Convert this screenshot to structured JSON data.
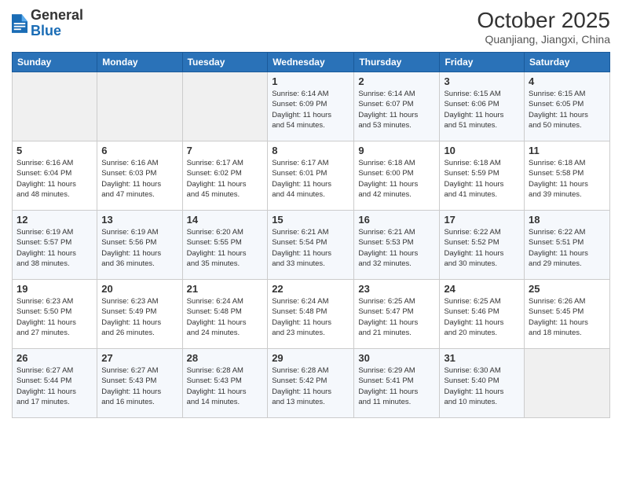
{
  "logo": {
    "general": "General",
    "blue": "Blue"
  },
  "header": {
    "title": "October 2025",
    "subtitle": "Quanjiang, Jiangxi, China"
  },
  "columns": [
    "Sunday",
    "Monday",
    "Tuesday",
    "Wednesday",
    "Thursday",
    "Friday",
    "Saturday"
  ],
  "weeks": [
    [
      {
        "day": "",
        "info": ""
      },
      {
        "day": "",
        "info": ""
      },
      {
        "day": "",
        "info": ""
      },
      {
        "day": "1",
        "info": "Sunrise: 6:14 AM\nSunset: 6:09 PM\nDaylight: 11 hours\nand 54 minutes."
      },
      {
        "day": "2",
        "info": "Sunrise: 6:14 AM\nSunset: 6:07 PM\nDaylight: 11 hours\nand 53 minutes."
      },
      {
        "day": "3",
        "info": "Sunrise: 6:15 AM\nSunset: 6:06 PM\nDaylight: 11 hours\nand 51 minutes."
      },
      {
        "day": "4",
        "info": "Sunrise: 6:15 AM\nSunset: 6:05 PM\nDaylight: 11 hours\nand 50 minutes."
      }
    ],
    [
      {
        "day": "5",
        "info": "Sunrise: 6:16 AM\nSunset: 6:04 PM\nDaylight: 11 hours\nand 48 minutes."
      },
      {
        "day": "6",
        "info": "Sunrise: 6:16 AM\nSunset: 6:03 PM\nDaylight: 11 hours\nand 47 minutes."
      },
      {
        "day": "7",
        "info": "Sunrise: 6:17 AM\nSunset: 6:02 PM\nDaylight: 11 hours\nand 45 minutes."
      },
      {
        "day": "8",
        "info": "Sunrise: 6:17 AM\nSunset: 6:01 PM\nDaylight: 11 hours\nand 44 minutes."
      },
      {
        "day": "9",
        "info": "Sunrise: 6:18 AM\nSunset: 6:00 PM\nDaylight: 11 hours\nand 42 minutes."
      },
      {
        "day": "10",
        "info": "Sunrise: 6:18 AM\nSunset: 5:59 PM\nDaylight: 11 hours\nand 41 minutes."
      },
      {
        "day": "11",
        "info": "Sunrise: 6:18 AM\nSunset: 5:58 PM\nDaylight: 11 hours\nand 39 minutes."
      }
    ],
    [
      {
        "day": "12",
        "info": "Sunrise: 6:19 AM\nSunset: 5:57 PM\nDaylight: 11 hours\nand 38 minutes."
      },
      {
        "day": "13",
        "info": "Sunrise: 6:19 AM\nSunset: 5:56 PM\nDaylight: 11 hours\nand 36 minutes."
      },
      {
        "day": "14",
        "info": "Sunrise: 6:20 AM\nSunset: 5:55 PM\nDaylight: 11 hours\nand 35 minutes."
      },
      {
        "day": "15",
        "info": "Sunrise: 6:21 AM\nSunset: 5:54 PM\nDaylight: 11 hours\nand 33 minutes."
      },
      {
        "day": "16",
        "info": "Sunrise: 6:21 AM\nSunset: 5:53 PM\nDaylight: 11 hours\nand 32 minutes."
      },
      {
        "day": "17",
        "info": "Sunrise: 6:22 AM\nSunset: 5:52 PM\nDaylight: 11 hours\nand 30 minutes."
      },
      {
        "day": "18",
        "info": "Sunrise: 6:22 AM\nSunset: 5:51 PM\nDaylight: 11 hours\nand 29 minutes."
      }
    ],
    [
      {
        "day": "19",
        "info": "Sunrise: 6:23 AM\nSunset: 5:50 PM\nDaylight: 11 hours\nand 27 minutes."
      },
      {
        "day": "20",
        "info": "Sunrise: 6:23 AM\nSunset: 5:49 PM\nDaylight: 11 hours\nand 26 minutes."
      },
      {
        "day": "21",
        "info": "Sunrise: 6:24 AM\nSunset: 5:48 PM\nDaylight: 11 hours\nand 24 minutes."
      },
      {
        "day": "22",
        "info": "Sunrise: 6:24 AM\nSunset: 5:48 PM\nDaylight: 11 hours\nand 23 minutes."
      },
      {
        "day": "23",
        "info": "Sunrise: 6:25 AM\nSunset: 5:47 PM\nDaylight: 11 hours\nand 21 minutes."
      },
      {
        "day": "24",
        "info": "Sunrise: 6:25 AM\nSunset: 5:46 PM\nDaylight: 11 hours\nand 20 minutes."
      },
      {
        "day": "25",
        "info": "Sunrise: 6:26 AM\nSunset: 5:45 PM\nDaylight: 11 hours\nand 18 minutes."
      }
    ],
    [
      {
        "day": "26",
        "info": "Sunrise: 6:27 AM\nSunset: 5:44 PM\nDaylight: 11 hours\nand 17 minutes."
      },
      {
        "day": "27",
        "info": "Sunrise: 6:27 AM\nSunset: 5:43 PM\nDaylight: 11 hours\nand 16 minutes."
      },
      {
        "day": "28",
        "info": "Sunrise: 6:28 AM\nSunset: 5:43 PM\nDaylight: 11 hours\nand 14 minutes."
      },
      {
        "day": "29",
        "info": "Sunrise: 6:28 AM\nSunset: 5:42 PM\nDaylight: 11 hours\nand 13 minutes."
      },
      {
        "day": "30",
        "info": "Sunrise: 6:29 AM\nSunset: 5:41 PM\nDaylight: 11 hours\nand 11 minutes."
      },
      {
        "day": "31",
        "info": "Sunrise: 6:30 AM\nSunset: 5:40 PM\nDaylight: 11 hours\nand 10 minutes."
      },
      {
        "day": "",
        "info": ""
      }
    ]
  ]
}
